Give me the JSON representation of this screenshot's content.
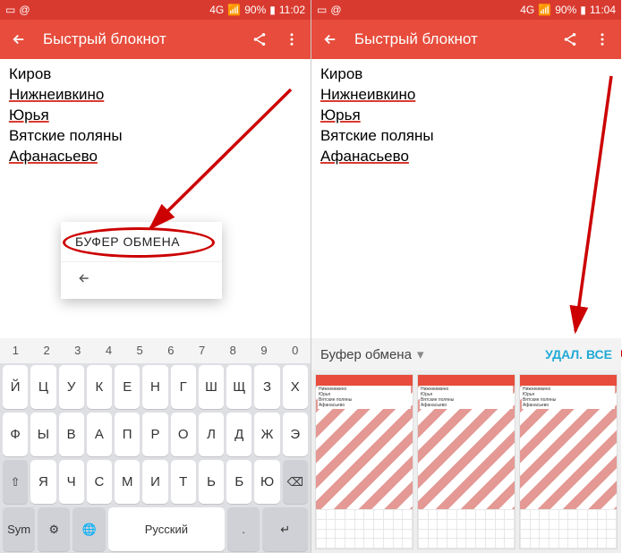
{
  "left": {
    "status": {
      "network": "4G",
      "battery": "90%",
      "time": "11:02"
    },
    "appbar": {
      "title": "Быстрый блокнот"
    },
    "notes": [
      "Киров",
      "Нижнеивкино",
      "Юрья",
      "Вятские поляны",
      "Афанасьево"
    ],
    "underlined": [
      1,
      2,
      4
    ],
    "popup": {
      "label": "БУФЕР ОБМЕНА"
    },
    "numbers": [
      "1",
      "2",
      "3",
      "4",
      "5",
      "6",
      "7",
      "8",
      "9",
      "0"
    ],
    "keyboard": {
      "row1": [
        "Й",
        "Ц",
        "У",
        "К",
        "Е",
        "Н",
        "Г",
        "Ш",
        "Щ",
        "З",
        "Х"
      ],
      "row2": [
        "Ф",
        "Ы",
        "В",
        "А",
        "П",
        "Р",
        "О",
        "Л",
        "Д",
        "Ж",
        "Э"
      ],
      "row3": [
        "⇧",
        "Я",
        "Ч",
        "С",
        "М",
        "И",
        "Т",
        "Ь",
        "Б",
        "Ю",
        "⌫"
      ],
      "row4": {
        "sym": "Sym",
        "gear": "⚙",
        "lang": "🌐",
        "space": "Русский",
        "dot": ".",
        "enter": "↵"
      }
    }
  },
  "right": {
    "status": {
      "network": "4G",
      "battery": "90%",
      "time": "11:04"
    },
    "appbar": {
      "title": "Быстрый блокнот"
    },
    "notes": [
      "Киров",
      "Нижнеивкино",
      "Юрья",
      "Вятские поляны",
      "Афанасьево"
    ],
    "underlined": [
      1,
      2,
      4
    ],
    "clipboard": {
      "header": "Буфер обмена",
      "delete_all": "УДАЛ. ВСЕ"
    }
  }
}
